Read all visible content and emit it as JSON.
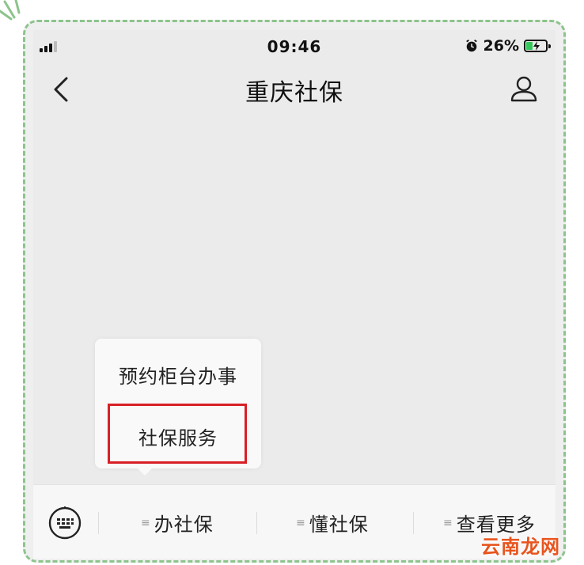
{
  "status": {
    "time": "09:46",
    "battery": "26%",
    "signal_icon": "signal-icon",
    "alarm_icon": "alarm-icon"
  },
  "header": {
    "title": "重庆社保",
    "back_icon": "chevron-left-icon",
    "profile_icon": "user-icon"
  },
  "popup_menu": {
    "items": [
      "预约柜台办事",
      "社保服务"
    ],
    "highlighted_index": 1,
    "highlight_color": "#d81f26"
  },
  "bottom_tabs": [
    {
      "label": "办社保"
    },
    {
      "label": "懂社保"
    },
    {
      "label": "查看更多"
    }
  ],
  "watermark": "云南龙网",
  "colors": {
    "frame_border": "#8cc48c",
    "battery_fill": "#34c759",
    "watermark": "#e8541e"
  }
}
